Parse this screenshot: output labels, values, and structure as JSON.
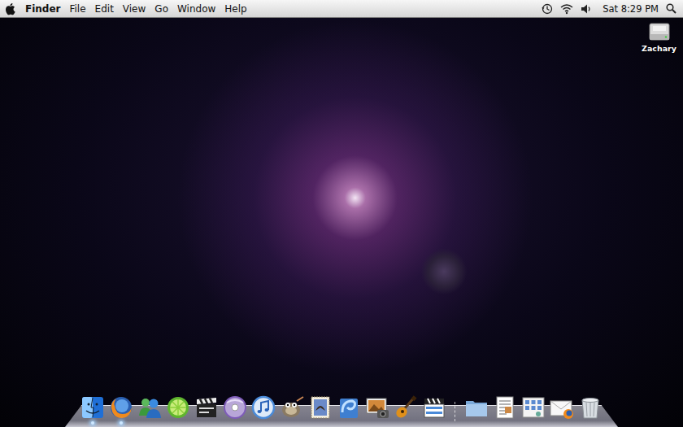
{
  "menu_bar": {
    "app": "Finder",
    "items": [
      "File",
      "Edit",
      "View",
      "Go",
      "Window",
      "Help"
    ],
    "clock": "Sat 8:29 PM"
  },
  "desktop_icons": [
    {
      "label": "Zachary"
    }
  ],
  "dock": {
    "apps": [
      {
        "kind": "finder",
        "running": true
      },
      {
        "kind": "firefox",
        "running": true
      },
      {
        "kind": "messenger",
        "running": false
      },
      {
        "kind": "limewire",
        "running": false
      },
      {
        "kind": "clapper",
        "running": false
      },
      {
        "kind": "dvd",
        "running": false
      },
      {
        "kind": "itunes",
        "running": false
      },
      {
        "kind": "gimp",
        "running": false
      },
      {
        "kind": "mail",
        "running": false
      },
      {
        "kind": "wave",
        "running": false
      },
      {
        "kind": "iphoto",
        "running": false
      },
      {
        "kind": "garageband",
        "running": false
      },
      {
        "kind": "imovie",
        "running": false
      }
    ],
    "stacks": [
      {
        "kind": "folder",
        "running": false
      },
      {
        "kind": "documents",
        "running": false
      },
      {
        "kind": "applications",
        "running": false
      },
      {
        "kind": "downloads",
        "running": false
      },
      {
        "kind": "trash",
        "running": false
      }
    ]
  }
}
